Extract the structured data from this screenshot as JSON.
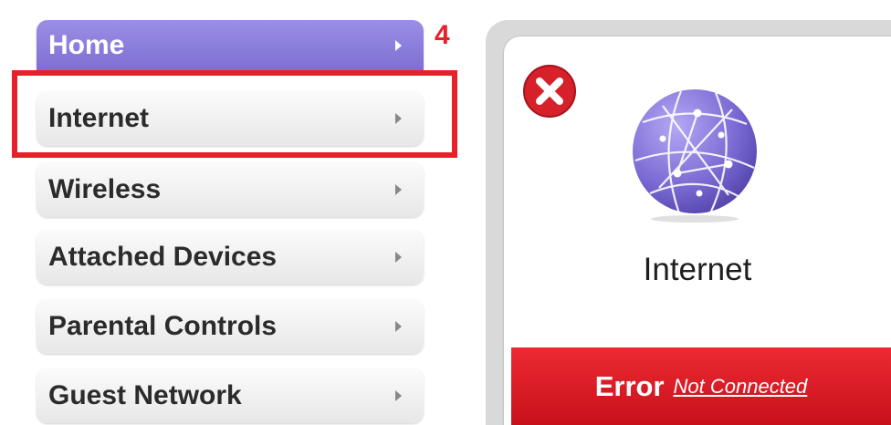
{
  "menu": {
    "items": [
      {
        "label": "Home",
        "active": true
      },
      {
        "label": "Internet",
        "active": false
      },
      {
        "label": "Wireless",
        "active": false
      },
      {
        "label": "Attached Devices",
        "active": false
      },
      {
        "label": "Parental Controls",
        "active": false
      },
      {
        "label": "Guest Network",
        "active": false
      }
    ]
  },
  "annotation": {
    "step_number": "4",
    "highlight_color": "#e8202a"
  },
  "card": {
    "title": "Internet",
    "status_word": "Error",
    "status_link": "Not Connected",
    "status_icon": "error-x-icon",
    "main_icon": "globe-network-icon",
    "error_color": "#e8202a",
    "accent_color": "#8070d8"
  }
}
